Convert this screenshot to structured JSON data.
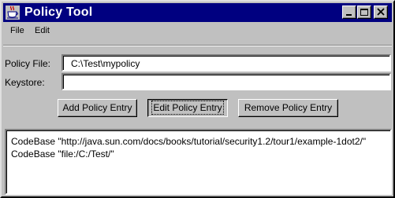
{
  "window": {
    "title": "Policy Tool"
  },
  "title_buttons": {
    "minimize": "minimize-icon",
    "maximize": "maximize-icon",
    "close": "close-icon"
  },
  "menu": [
    "File",
    "Edit"
  ],
  "form": {
    "policy_file_label": "Policy File:",
    "policy_file_value": "C:\\Test\\mypolicy",
    "keystore_label": "Keystore:",
    "keystore_value": ""
  },
  "buttons": {
    "add": "Add Policy Entry",
    "edit": "Edit Policy Entry",
    "remove": "Remove Policy Entry"
  },
  "entries": [
    "CodeBase \"http://java.sun.com/docs/books/tutorial/security1.2/tour1/example-1dot2/\"",
    "CodeBase \"file:/C:/Test/\""
  ],
  "colors": {
    "titlebar": "#000080",
    "face": "#c0c0c0"
  }
}
